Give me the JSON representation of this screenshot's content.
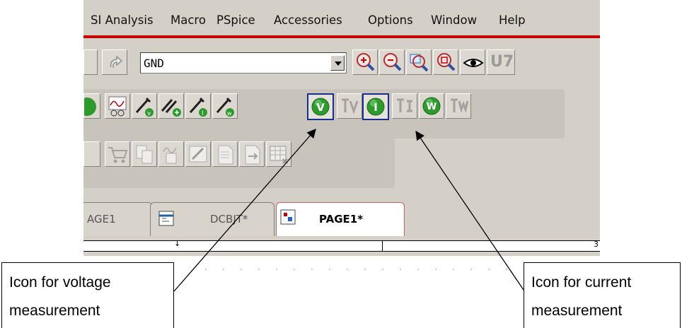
{
  "menu": {
    "items": [
      "SI Analysis",
      "Macro",
      "PSpice",
      "Accessories",
      "Options",
      "Window",
      "Help"
    ]
  },
  "toolbar": {
    "net_combo_value": "GND",
    "partial_label": "U7"
  },
  "probe_toolbar": {
    "voltage_marker_letter": "V",
    "current_marker_letter": "I",
    "power_marker_letter": "W"
  },
  "tabs": [
    {
      "label": "AGE1",
      "active": false
    },
    {
      "label": "DCBJT*",
      "active": false
    },
    {
      "label": "PAGE1*",
      "active": true
    }
  ],
  "ruler": {
    "right_number": "3"
  },
  "callouts": {
    "voltage": "Icon for voltage measurement",
    "current": "Icon for current measurement"
  },
  "colors": {
    "menu_underline": "#c40000",
    "marker_green": "#2e9a2e",
    "selection_border": "#1a2e8c",
    "toolbar_bg": "#d4d0c8"
  }
}
